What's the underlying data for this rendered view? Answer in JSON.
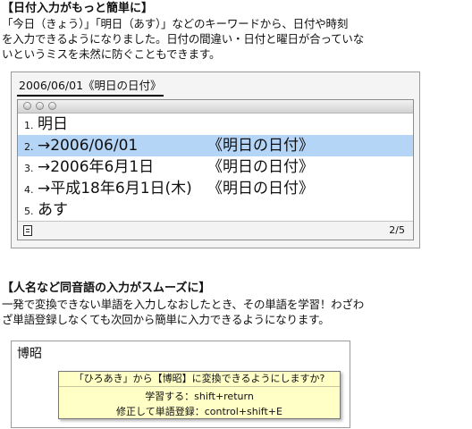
{
  "section1": {
    "heading": "【日付入力がもっと簡単に】",
    "lines": [
      "「今日（きょう）」「明日（あす）」などのキーワードから、日付や時刻",
      "を入力できるようになりました。日付の間違い・日付と曜日が合っていな",
      "いというミスを未然に防ぐこともできます。"
    ]
  },
  "ime": {
    "input_text": "2006/06/01《明日の日付》",
    "candidates": [
      {
        "num": "1.",
        "word": "明日",
        "ann": ""
      },
      {
        "num": "2.",
        "word": "→2006/06/01",
        "ann": "《明日の日付》"
      },
      {
        "num": "3.",
        "word": "→2006年6月1日",
        "ann": "《明日の日付》"
      },
      {
        "num": "4.",
        "word": "→平成18年6月1日(木)",
        "ann": "《明日の日付》"
      },
      {
        "num": "5.",
        "word": "あす",
        "ann": ""
      }
    ],
    "selected_index": 1,
    "page_count": "2/5",
    "colors": {
      "selection": "#b5d5f7"
    },
    "icons": {
      "status": "document-icon"
    }
  },
  "section2": {
    "heading": "【人名など同音語の入力がスムーズに】",
    "lines": [
      "一発で変換できない単語を入力しなおしたとき、その単語を学習！わざわ",
      "ざ単語登録しなくても次回から簡単に入力できるようになります。"
    ]
  },
  "learn": {
    "word": "博昭",
    "question": "「ひろあき」から【博昭】に変換できるようにしますか?",
    "learn_line": "学習する：shift+return",
    "register_line": "修正して単語登録：control+shift+E",
    "colors": {
      "tooltip_bg": "#ffffc6"
    }
  }
}
